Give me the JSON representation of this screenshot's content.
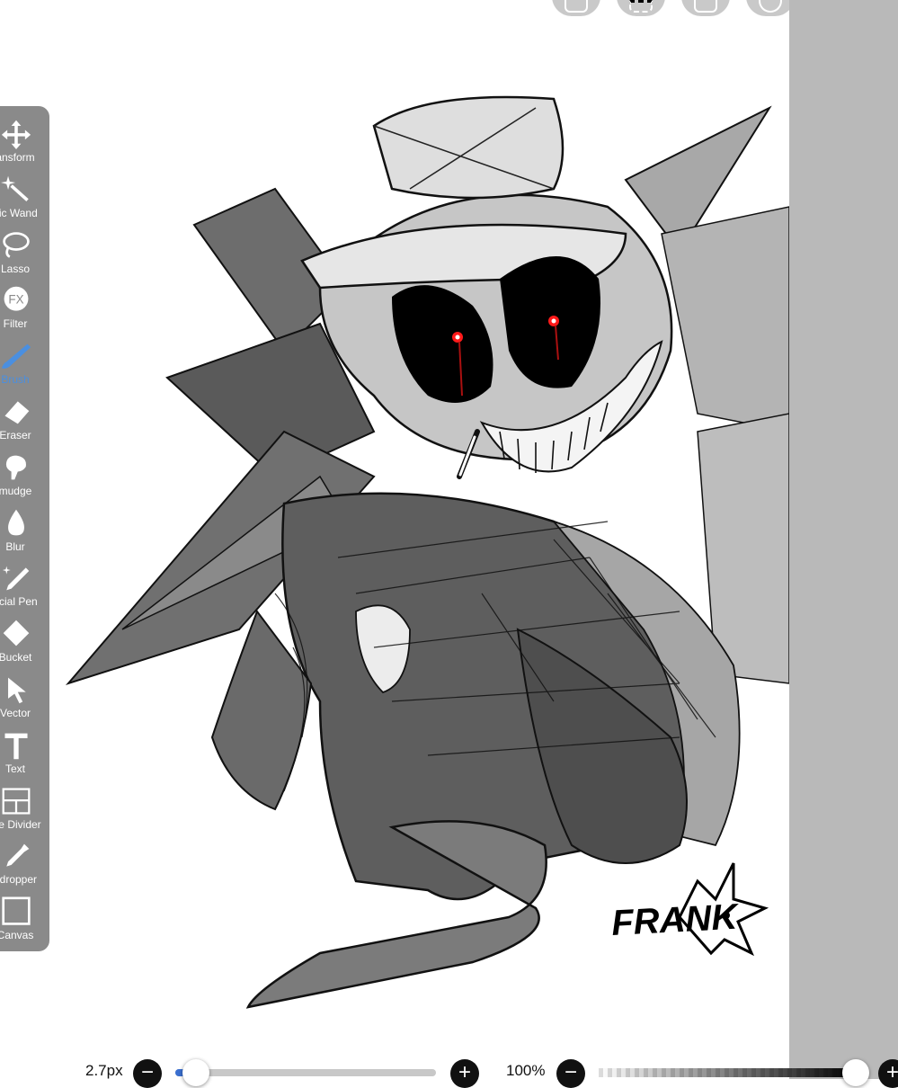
{
  "tools": [
    {
      "label": "ansform",
      "icon": "move-arrows-icon"
    },
    {
      "label": "gic Wand",
      "icon": "magic-wand-icon"
    },
    {
      "label": "Lasso",
      "icon": "lasso-icon"
    },
    {
      "label": "Filter",
      "icon": "fx-icon"
    },
    {
      "label": "Brush",
      "icon": "brush-icon",
      "active": true
    },
    {
      "label": "Eraser",
      "icon": "eraser-icon"
    },
    {
      "label": "mudge",
      "icon": "smudge-icon"
    },
    {
      "label": "Blur",
      "icon": "droplet-icon"
    },
    {
      "label": "ecial Pen",
      "icon": "special-pen-icon"
    },
    {
      "label": "Bucket",
      "icon": "bucket-icon"
    },
    {
      "label": "Vector",
      "icon": "cursor-arrow-icon"
    },
    {
      "label": "Text",
      "icon": "text-t-icon"
    },
    {
      "label": "me Divider",
      "icon": "frame-divider-icon"
    },
    {
      "label": "edropper",
      "icon": "eyedropper-icon"
    },
    {
      "label": "Canvas",
      "icon": "canvas-icon"
    }
  ],
  "artwork": {
    "signature": "FRANK"
  },
  "bottom_bar": {
    "brush_size": "2.7px",
    "brush_size_fraction": 0.08,
    "opacity": "100%",
    "opacity_fraction": 1.0
  },
  "colors": {
    "accent": "#4a8fe0",
    "panel": "#8a8a8a",
    "workspace": "#b9b9b9",
    "eye_red": "#ff1a1a"
  }
}
